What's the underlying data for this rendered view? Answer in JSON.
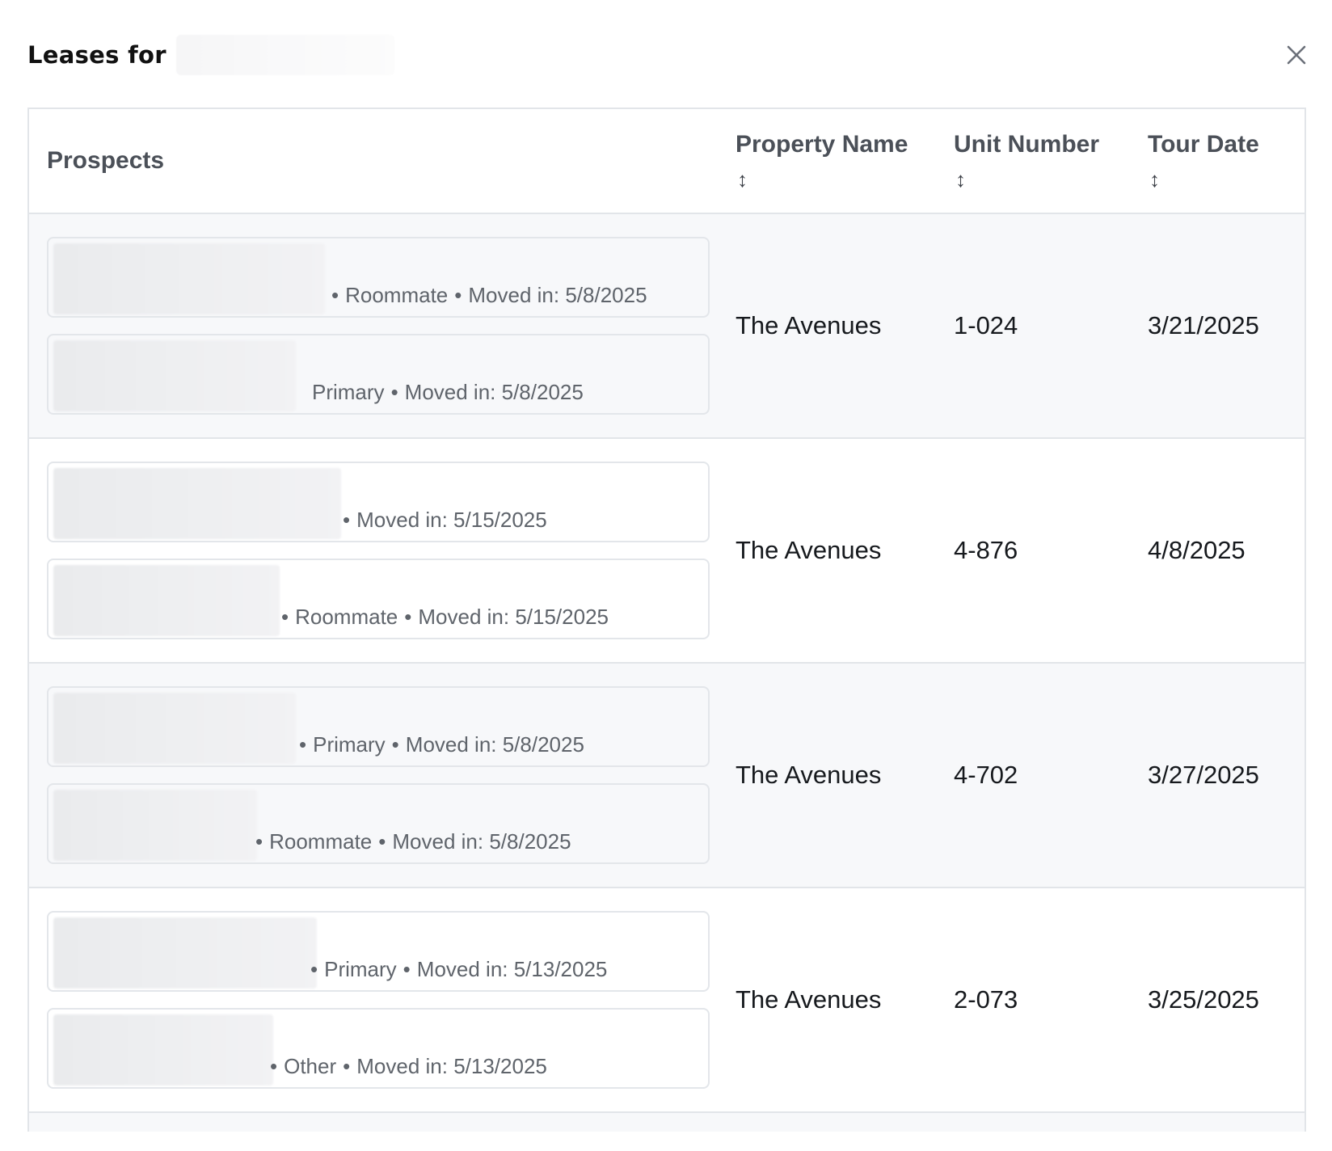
{
  "modal": {
    "title": "Leases for",
    "close_icon": "close-icon"
  },
  "table": {
    "headers": {
      "prospects": "Prospects",
      "property_name": "Property Name",
      "unit_number": "Unit Number",
      "tour_date": "Tour Date",
      "sort_glyph": "↕"
    },
    "rows": [
      {
        "prospects": [
          {
            "role": "Roommate",
            "moved_in": "Moved in: 5/8/2025"
          },
          {
            "role": "Primary",
            "moved_in": "Moved in: 5/8/2025"
          }
        ],
        "property_name": "The Avenues",
        "unit_number": "1-024",
        "tour_date": "3/21/2025"
      },
      {
        "prospects": [
          {
            "role": "",
            "moved_in": "Moved in: 5/15/2025"
          },
          {
            "role": "Roommate",
            "moved_in": "Moved in: 5/15/2025"
          }
        ],
        "property_name": "The Avenues",
        "unit_number": "4-876",
        "tour_date": "4/8/2025"
      },
      {
        "prospects": [
          {
            "role": "Primary",
            "moved_in": "Moved in: 5/8/2025"
          },
          {
            "role": "Roommate",
            "moved_in": "Moved in: 5/8/2025"
          }
        ],
        "property_name": "The Avenues",
        "unit_number": "4-702",
        "tour_date": "3/27/2025"
      },
      {
        "prospects": [
          {
            "role": "Primary",
            "moved_in": "Moved in: 5/13/2025"
          },
          {
            "role": "Other",
            "moved_in": "Moved in: 5/13/2025"
          }
        ],
        "property_name": "The Avenues",
        "unit_number": "2-073",
        "tour_date": "3/25/2025"
      }
    ]
  }
}
